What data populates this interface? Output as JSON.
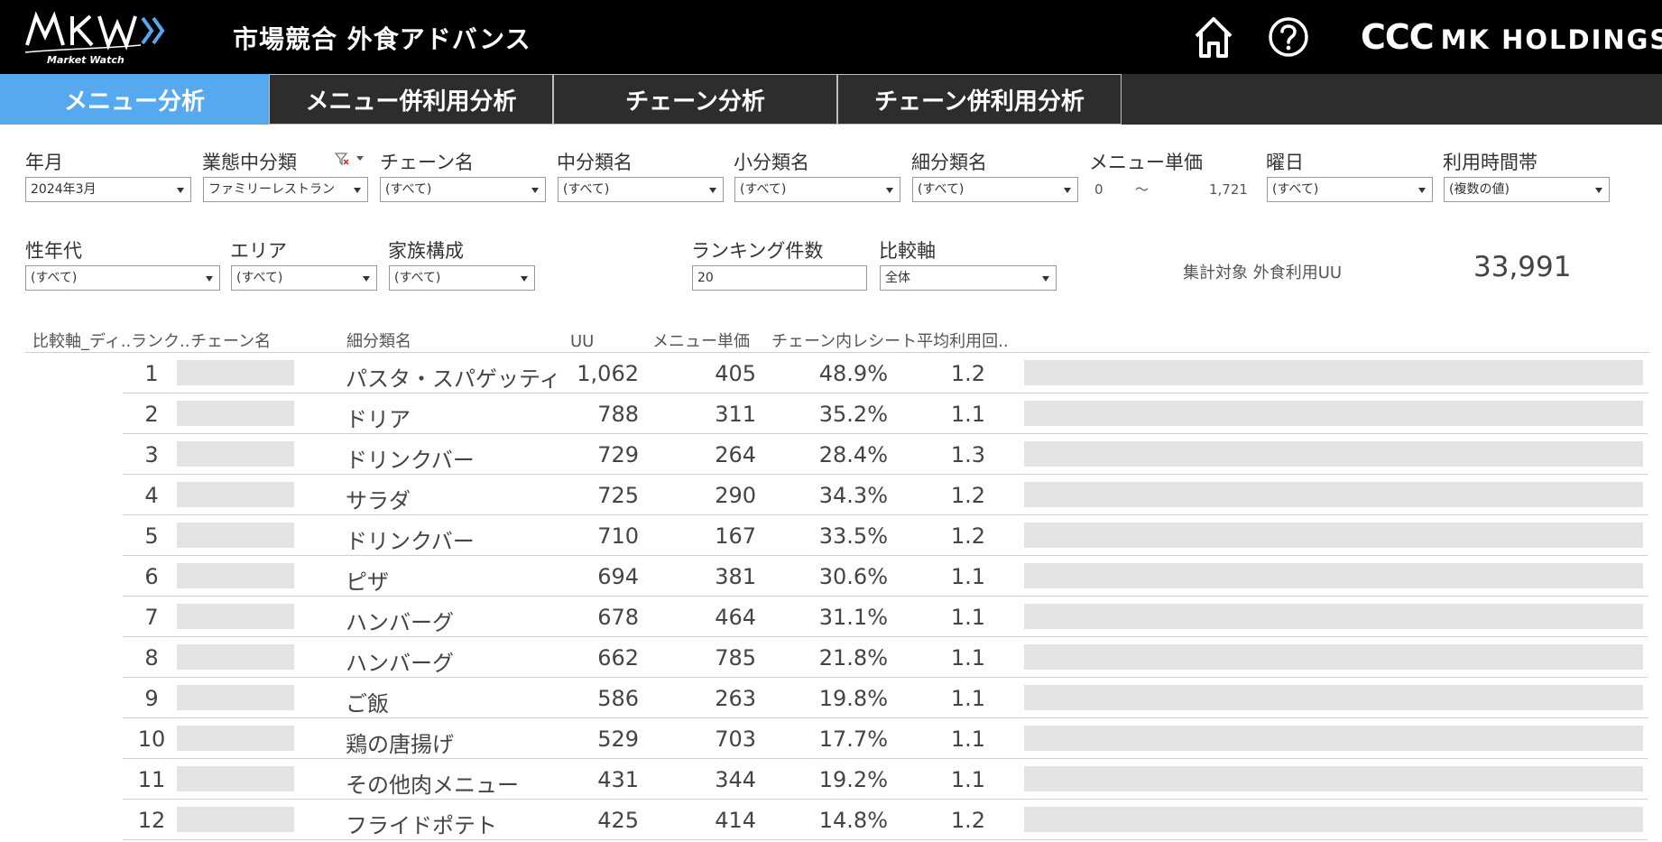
{
  "header": {
    "logo_text": "MKW",
    "logo_sub": "Market Watch",
    "title": "市場競合 外食アドバンス",
    "brand_ccc": "CCC",
    "brand_mk": "MK HOLDINGS",
    "home_icon": "home-icon",
    "help_icon": "help-icon"
  },
  "tabs": [
    {
      "label": "メニュー分析",
      "active": true
    },
    {
      "label": "メニュー併利用分析",
      "active": false
    },
    {
      "label": "チェーン分析",
      "active": false
    },
    {
      "label": "チェーン併利用分析",
      "active": false
    }
  ],
  "filters": {
    "year_month": {
      "label": "年月",
      "value": "2024年3月"
    },
    "business_mid": {
      "label": "業態中分類",
      "value": "ファミリーレストラン"
    },
    "chain_name": {
      "label": "チェーン名",
      "value": "(すべて)"
    },
    "mid_category": {
      "label": "中分類名",
      "value": "(すべて)"
    },
    "small_category": {
      "label": "小分類名",
      "value": "(すべて)"
    },
    "detail_category": {
      "label": "細分類名",
      "value": "(すべて)"
    },
    "menu_price": {
      "label": "メニュー単価",
      "min": "0",
      "sep": "〜",
      "max": "1,721"
    },
    "weekday": {
      "label": "曜日",
      "value": "(すべて)"
    },
    "time_band": {
      "label": "利用時間帯",
      "value": "(複数の値)"
    },
    "gender_age": {
      "label": "性年代",
      "value": "(すべて)"
    },
    "area": {
      "label": "エリア",
      "value": "(すべて)"
    },
    "family": {
      "label": "家族構成",
      "value": "(すべて)"
    },
    "ranking_count": {
      "label": "ランキング件数",
      "value": "20"
    },
    "compare_axis": {
      "label": "比較軸",
      "value": "全体"
    }
  },
  "kpi": {
    "label": "集計対象 外食利用UU",
    "value": "33,991"
  },
  "table": {
    "columns": [
      "比較軸_ディ..",
      "ランク..",
      "チェーン名",
      "細分類名",
      "UU",
      "メニュー単価",
      "チェーン内レシート平均利用回.."
    ],
    "rows": [
      {
        "rank": "1",
        "name": "パスタ・スパゲッティ",
        "uu": "1,062",
        "price": "405",
        "pct": "48.9%",
        "avg": "1.2"
      },
      {
        "rank": "2",
        "name": "ドリア",
        "uu": "788",
        "price": "311",
        "pct": "35.2%",
        "avg": "1.1"
      },
      {
        "rank": "3",
        "name": "ドリンクバー",
        "uu": "729",
        "price": "264",
        "pct": "28.4%",
        "avg": "1.3"
      },
      {
        "rank": "4",
        "name": "サラダ",
        "uu": "725",
        "price": "290",
        "pct": "34.3%",
        "avg": "1.2"
      },
      {
        "rank": "5",
        "name": "ドリンクバー",
        "uu": "710",
        "price": "167",
        "pct": "33.5%",
        "avg": "1.2"
      },
      {
        "rank": "6",
        "name": "ピザ",
        "uu": "694",
        "price": "381",
        "pct": "30.6%",
        "avg": "1.1"
      },
      {
        "rank": "7",
        "name": "ハンバーグ",
        "uu": "678",
        "price": "464",
        "pct": "31.1%",
        "avg": "1.1"
      },
      {
        "rank": "8",
        "name": "ハンバーグ",
        "uu": "662",
        "price": "785",
        "pct": "21.8%",
        "avg": "1.1"
      },
      {
        "rank": "9",
        "name": "ご飯",
        "uu": "586",
        "price": "263",
        "pct": "19.8%",
        "avg": "1.1"
      },
      {
        "rank": "10",
        "name": "鶏の唐揚げ",
        "uu": "529",
        "price": "703",
        "pct": "17.7%",
        "avg": "1.1"
      },
      {
        "rank": "11",
        "name": "その他肉メニュー",
        "uu": "431",
        "price": "344",
        "pct": "19.2%",
        "avg": "1.1"
      },
      {
        "rank": "12",
        "name": "フライドポテト",
        "uu": "425",
        "price": "414",
        "pct": "14.8%",
        "avg": "1.2"
      }
    ]
  },
  "colors": {
    "header_bg": "#000000",
    "tab_bg": "#2d2d2d",
    "tab_active": "#56a8ef",
    "redacted": "#e3e3e3"
  }
}
